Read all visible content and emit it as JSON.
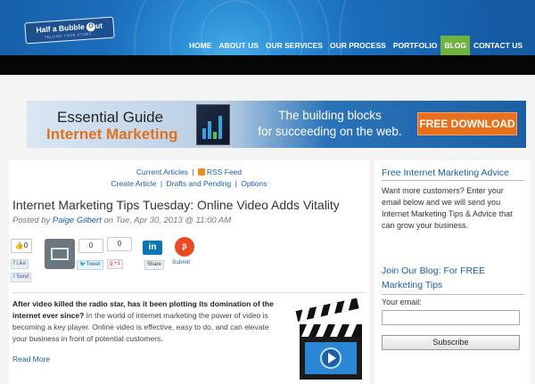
{
  "header": {
    "logo_text": "Half a Bubble",
    "logo_o": "O",
    "logo_text2": "ut",
    "logo_tagline": "TELLING YOUR STORY...",
    "nav": [
      {
        "label": "HOME"
      },
      {
        "label": "ABOUT US"
      },
      {
        "label": "OUR SERVICES"
      },
      {
        "label": "OUR PROCESS"
      },
      {
        "label": "PORTFOLIO"
      },
      {
        "label": "BLOG",
        "active": true
      },
      {
        "label": "CONTACT US"
      }
    ],
    "active_color": "#6fb23e",
    "brand_color": "#1c6fbd"
  },
  "banner": {
    "line1": "Essential Guide",
    "line2": "Internet Marketing",
    "tagline1": "The building blocks",
    "tagline2": "for succeeding on the web.",
    "button_label": "FREE DOWNLOAD",
    "button_color": "#e86f1c"
  },
  "blog_links": {
    "current_articles": "Current Articles",
    "rss_feed": "RSS Feed",
    "create_article": "Create Article",
    "drafts": "Drafts and Pending",
    "options": "Options",
    "separator": "|"
  },
  "post": {
    "title": "Internet Marketing Tips Tuesday: Online Video Adds Vitality",
    "posted_by_prefix": "Posted by",
    "author": "Paige Gilbert",
    "date": "on Tue, Apr 30, 2013 @ 11:00 AM",
    "excerpt_bold": "After video killed the radio star, has it been plotting its domination of the internet ever since?",
    "excerpt_rest": " In the world of internet marketing the power of video is becoming a key player. Online video is effective, easy to do, and can elevate your business in front of potential customers.",
    "read_more": "Read More"
  },
  "share": {
    "fb_count": "0",
    "fb_like": "Like",
    "fb_send": "Send",
    "tweet_count": "0",
    "tweet_label": "Tweet",
    "gplus_count": "0",
    "gplus_label": "+1",
    "linkedin_logo": "in",
    "linkedin_label": "Share",
    "stumble_label": "Submit",
    "icons": [
      "facebook-icon",
      "email-icon",
      "twitter-icon",
      "google-plus-icon",
      "linkedin-icon",
      "stumbleupon-icon"
    ]
  },
  "sidebar": {
    "advice_title": "Free Internet Marketing Advice",
    "advice_text": "Want more customers? Enter your email below and we will send you Internet Marketing Tips & Advice that can grow your business.",
    "subscribe_title": "Join Our Blog: For FREE Marketing Tips",
    "email_label": "Your email:",
    "email_value": "",
    "subscribe_button": "Subscribe"
  }
}
